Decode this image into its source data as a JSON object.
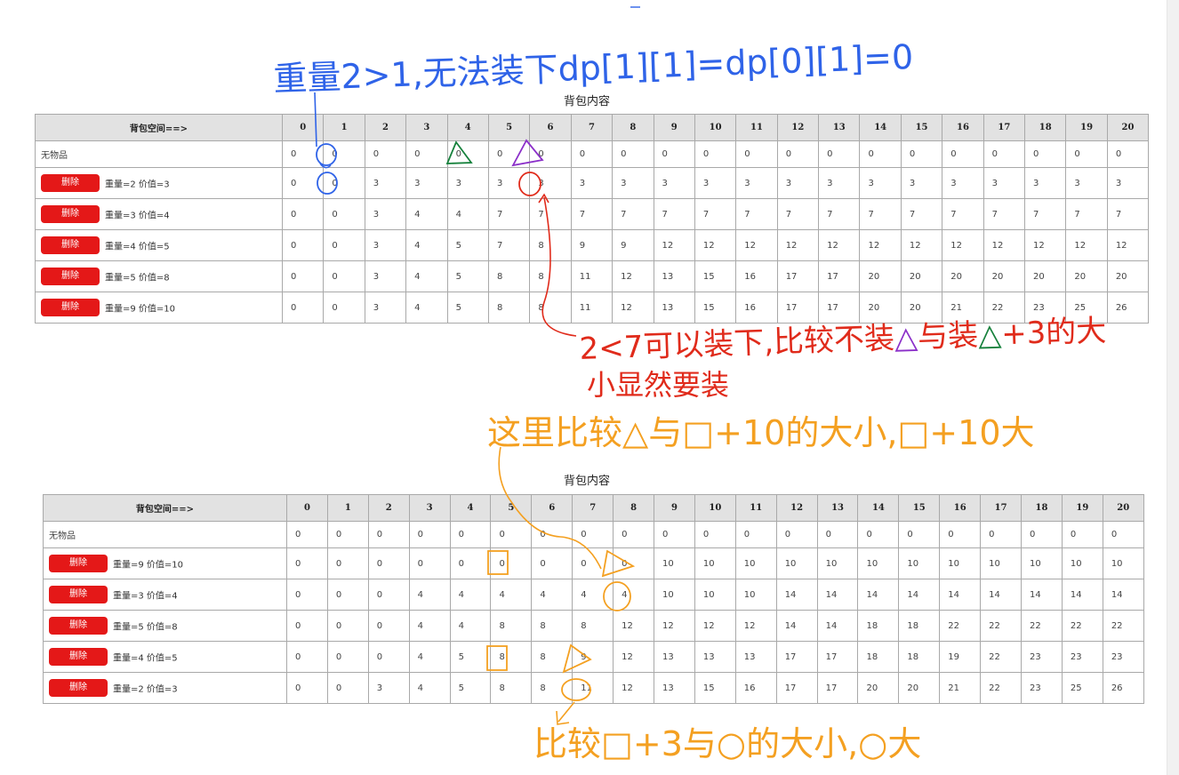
{
  "colors": {
    "blue": "#2f63e8",
    "red": "#e02b1b",
    "orange": "#f4a021",
    "green": "#16813c",
    "purple": "#8b2fc9",
    "delete_button": "#e41818"
  },
  "table1": {
    "caption": "背包内容",
    "header_label": "背包空间==>",
    "capacities": [
      "0",
      "1",
      "2",
      "3",
      "4",
      "5",
      "6",
      "7",
      "8",
      "9",
      "10",
      "11",
      "12",
      "13",
      "14",
      "15",
      "16",
      "17",
      "18",
      "19",
      "20"
    ],
    "empty_row_label": "无物品",
    "empty_row_values": [
      "0",
      "0",
      "0",
      "0",
      "0",
      "0",
      "0",
      "0",
      "0",
      "0",
      "0",
      "0",
      "0",
      "0",
      "0",
      "0",
      "0",
      "0",
      "0",
      "0",
      "0"
    ],
    "rows": [
      {
        "delete_label": "删除",
        "item": "重量=2 价值=3",
        "values": [
          "0",
          "0",
          "3",
          "3",
          "3",
          "3",
          "3",
          "3",
          "3",
          "3",
          "3",
          "3",
          "3",
          "3",
          "3",
          "3",
          "3",
          "3",
          "3",
          "3",
          "3"
        ]
      },
      {
        "delete_label": "删除",
        "item": "重量=3 价值=4",
        "values": [
          "0",
          "0",
          "3",
          "4",
          "4",
          "7",
          "7",
          "7",
          "7",
          "7",
          "7",
          "7",
          "7",
          "7",
          "7",
          "7",
          "7",
          "7",
          "7",
          "7",
          "7"
        ]
      },
      {
        "delete_label": "删除",
        "item": "重量=4 价值=5",
        "values": [
          "0",
          "0",
          "3",
          "4",
          "5",
          "7",
          "8",
          "9",
          "9",
          "12",
          "12",
          "12",
          "12",
          "12",
          "12",
          "12",
          "12",
          "12",
          "12",
          "12",
          "12"
        ]
      },
      {
        "delete_label": "删除",
        "item": "重量=5 价值=8",
        "values": [
          "0",
          "0",
          "3",
          "4",
          "5",
          "8",
          "8",
          "11",
          "12",
          "13",
          "15",
          "16",
          "17",
          "17",
          "20",
          "20",
          "20",
          "20",
          "20",
          "20",
          "20"
        ]
      },
      {
        "delete_label": "删除",
        "item": "重量=9 价值=10",
        "values": [
          "0",
          "0",
          "3",
          "4",
          "5",
          "8",
          "8",
          "11",
          "12",
          "13",
          "15",
          "16",
          "17",
          "17",
          "20",
          "20",
          "21",
          "22",
          "23",
          "25",
          "26"
        ]
      }
    ]
  },
  "table2": {
    "caption": "背包内容",
    "header_label": "背包空间==>",
    "capacities": [
      "0",
      "1",
      "2",
      "3",
      "4",
      "5",
      "6",
      "7",
      "8",
      "9",
      "10",
      "11",
      "12",
      "13",
      "14",
      "15",
      "16",
      "17",
      "18",
      "19",
      "20"
    ],
    "empty_row_label": "无物品",
    "empty_row_values": [
      "0",
      "0",
      "0",
      "0",
      "0",
      "0",
      "0",
      "0",
      "0",
      "0",
      "0",
      "0",
      "0",
      "0",
      "0",
      "0",
      "0",
      "0",
      "0",
      "0",
      "0"
    ],
    "rows": [
      {
        "delete_label": "删除",
        "item": "重量=9 价值=10",
        "values": [
          "0",
          "0",
          "0",
          "0",
          "0",
          "0",
          "0",
          "0",
          "0",
          "10",
          "10",
          "10",
          "10",
          "10",
          "10",
          "10",
          "10",
          "10",
          "10",
          "10",
          "10"
        ]
      },
      {
        "delete_label": "删除",
        "item": "重量=3 价值=4",
        "values": [
          "0",
          "0",
          "0",
          "4",
          "4",
          "4",
          "4",
          "4",
          "4",
          "10",
          "10",
          "10",
          "14",
          "14",
          "14",
          "14",
          "14",
          "14",
          "14",
          "14",
          "14"
        ]
      },
      {
        "delete_label": "删除",
        "item": "重量=5 价值=8",
        "values": [
          "0",
          "0",
          "0",
          "4",
          "4",
          "8",
          "8",
          "8",
          "12",
          "12",
          "12",
          "12",
          "14",
          "14",
          "18",
          "18",
          "22",
          "22",
          "22",
          "22",
          "22"
        ]
      },
      {
        "delete_label": "删除",
        "item": "重量=4 价值=5",
        "values": [
          "0",
          "0",
          "0",
          "4",
          "5",
          "8",
          "8",
          "9",
          "12",
          "13",
          "13",
          "13",
          "17",
          "17",
          "18",
          "18",
          "19",
          "22",
          "23",
          "23",
          "23"
        ]
      },
      {
        "delete_label": "删除",
        "item": "重量=2 价值=3",
        "values": [
          "0",
          "0",
          "3",
          "4",
          "5",
          "8",
          "8",
          "11",
          "12",
          "13",
          "15",
          "16",
          "17",
          "17",
          "20",
          "20",
          "21",
          "22",
          "23",
          "25",
          "26"
        ]
      }
    ]
  },
  "annotations": {
    "blue_note": "重量2>1,无法装下dp[1][1]=dp[0][1]=0",
    "red_note_line1": "2<7可以装下,比较不装",
    "red_note_between": "与装",
    "red_note_plus": "+3",
    "red_note_tail": "的大",
    "red_note_line2": "小显然要装",
    "orange_note_top": "这里比较△与□+10的大小,□+10大",
    "orange_note_bottom": "比较□+3与○的大小,○大"
  }
}
